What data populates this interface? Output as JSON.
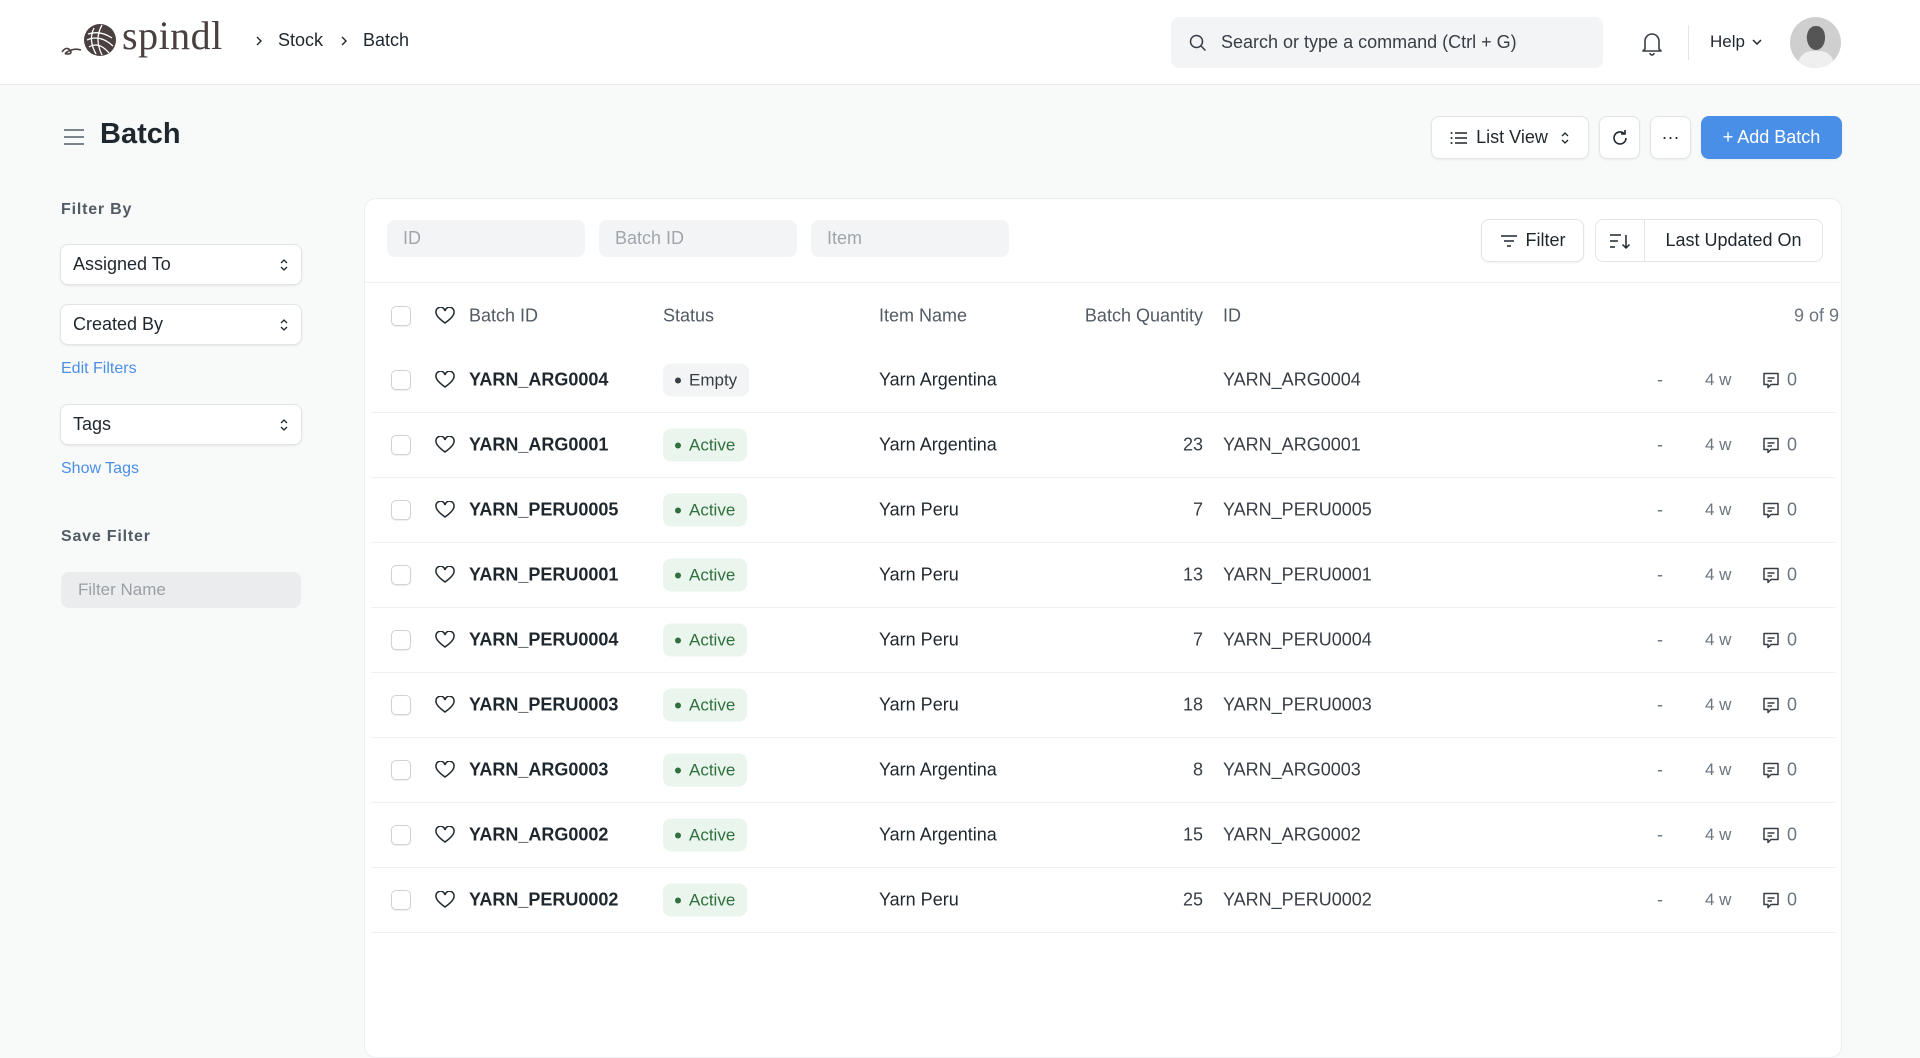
{
  "navbar": {
    "brand": "spindl",
    "breadcrumbs": [
      "Stock",
      "Batch"
    ],
    "search_placeholder": "Search or type a command (Ctrl + G)",
    "help_label": "Help"
  },
  "page": {
    "title": "Batch",
    "list_view_label": "List View",
    "more_label": "···",
    "add_label": "+ Add Batch"
  },
  "sidebar": {
    "filter_by_heading": "Filter By",
    "assigned_to": "Assigned To",
    "created_by": "Created By",
    "edit_filters": "Edit Filters",
    "tags": "Tags",
    "show_tags": "Show Tags",
    "save_filter_heading": "Save Filter",
    "filter_name_placeholder": "Filter Name"
  },
  "list": {
    "filters": {
      "id_placeholder": "ID",
      "batch_id_placeholder": "Batch ID",
      "item_placeholder": "Item"
    },
    "filter_button": "Filter",
    "sort_by": "Last Updated On",
    "columns": {
      "batch_id": "Batch ID",
      "status": "Status",
      "item_name": "Item Name",
      "batch_qty": "Batch Quantity",
      "id": "ID"
    },
    "count": "9 of 9",
    "rows": [
      {
        "batch_id": "YARN_ARG0004",
        "status": "Empty",
        "status_kind": "empty",
        "item_name": "Yarn Argentina",
        "qty": "",
        "id": "YARN_ARG0004",
        "assigned": "-",
        "modified": "4 w",
        "comments": "0"
      },
      {
        "batch_id": "YARN_ARG0001",
        "status": "Active",
        "status_kind": "active",
        "item_name": "Yarn Argentina",
        "qty": "23",
        "id": "YARN_ARG0001",
        "assigned": "-",
        "modified": "4 w",
        "comments": "0"
      },
      {
        "batch_id": "YARN_PERU0005",
        "status": "Active",
        "status_kind": "active",
        "item_name": "Yarn Peru",
        "qty": "7",
        "id": "YARN_PERU0005",
        "assigned": "-",
        "modified": "4 w",
        "comments": "0"
      },
      {
        "batch_id": "YARN_PERU0001",
        "status": "Active",
        "status_kind": "active",
        "item_name": "Yarn Peru",
        "qty": "13",
        "id": "YARN_PERU0001",
        "assigned": "-",
        "modified": "4 w",
        "comments": "0"
      },
      {
        "batch_id": "YARN_PERU0004",
        "status": "Active",
        "status_kind": "active",
        "item_name": "Yarn Peru",
        "qty": "7",
        "id": "YARN_PERU0004",
        "assigned": "-",
        "modified": "4 w",
        "comments": "0"
      },
      {
        "batch_id": "YARN_PERU0003",
        "status": "Active",
        "status_kind": "active",
        "item_name": "Yarn Peru",
        "qty": "18",
        "id": "YARN_PERU0003",
        "assigned": "-",
        "modified": "4 w",
        "comments": "0"
      },
      {
        "batch_id": "YARN_ARG0003",
        "status": "Active",
        "status_kind": "active",
        "item_name": "Yarn Argentina",
        "qty": "8",
        "id": "YARN_ARG0003",
        "assigned": "-",
        "modified": "4 w",
        "comments": "0"
      },
      {
        "batch_id": "YARN_ARG0002",
        "status": "Active",
        "status_kind": "active",
        "item_name": "Yarn Argentina",
        "qty": "15",
        "id": "YARN_ARG0002",
        "assigned": "-",
        "modified": "4 w",
        "comments": "0"
      },
      {
        "batch_id": "YARN_PERU0002",
        "status": "Active",
        "status_kind": "active",
        "item_name": "Yarn Peru",
        "qty": "25",
        "id": "YARN_PERU0002",
        "assigned": "-",
        "modified": "4 w",
        "comments": "0"
      }
    ]
  },
  "colors": {
    "primary": "#4a8fe7",
    "active_bg": "#eaf5ee",
    "active_text": "#30703d",
    "empty_bg": "#f3f4f5"
  }
}
